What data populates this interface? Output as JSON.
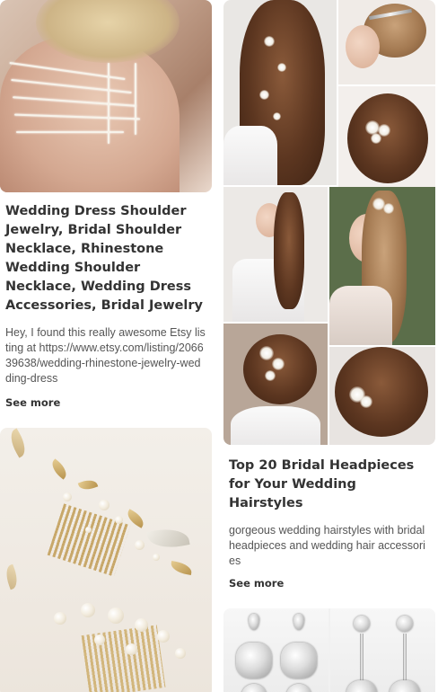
{
  "pins": [
    {
      "title": "Wedding Dress Shoulder Jewelry, Bridal Shoulder Necklace, Rhinestone Wedding Shoulder Necklace, Wedding Dress Accessories, Bridal Jewelry",
      "description": "Hey, I found this really awesome Etsy listing at https://www.etsy.com/listing/206639638/wedding-rhinestone-jewelry-wedding-dress",
      "see_more": "See more"
    },
    {
      "title": "Top 20 Bridal Headpieces for Your Wedding Hairstyles",
      "description": "gorgeous wedding hairstyles with bridal headpieces and wedding hair accessories",
      "see_more": "See more"
    }
  ]
}
